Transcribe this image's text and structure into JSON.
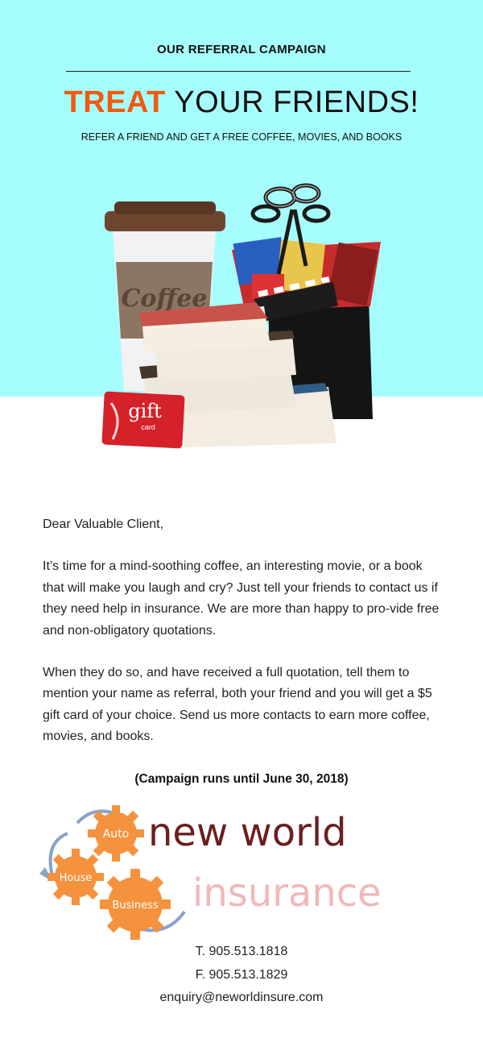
{
  "header": {
    "kicker": "OUR REFERRAL CAMPAIGN",
    "headline_accent": "TREAT",
    "headline_rest": " YOUR FRIENDS!",
    "subheadline": "REFER A FRIEND AND GET A FREE COFFEE, MOVIES, AND BOOKS"
  },
  "illustration": {
    "cup_label": "Coffee",
    "gift_card_top": "gift",
    "gift_card_bottom": "card"
  },
  "letter": {
    "greeting": "Dear Valuable Client,",
    "paragraph_1": "It’s time for a mind-soothing coffee, an interesting movie, or a book that will make you laugh and cry? Just tell your friends to contact us if they need help in insurance. We are more than happy to pro-vide free and non-obligatory quotations.",
    "paragraph_2": "When they do so, and have received a full quotation,  tell them to mention your name as referral, both your friend and you will get a $5 gift card of your choice. Send us more contacts to earn more coffee, movies, and books."
  },
  "campaign_note": "(Campaign runs until June 30, 2018)",
  "logo": {
    "line1": "new world",
    "line2": "insurance",
    "gear_auto": "Auto",
    "gear_house": "House",
    "gear_business": "Business"
  },
  "contact": {
    "phone": "T. 905.513.1818",
    "fax": "F. 905.513.1829",
    "email": "enquiry@neworldinsure.com"
  },
  "colors": {
    "hero_bg": "#a6fdfe",
    "accent": "#f15a0f",
    "logo_dark": "#6b1f1f",
    "logo_pink": "#f0b8b8",
    "gear": "#f5923e"
  }
}
